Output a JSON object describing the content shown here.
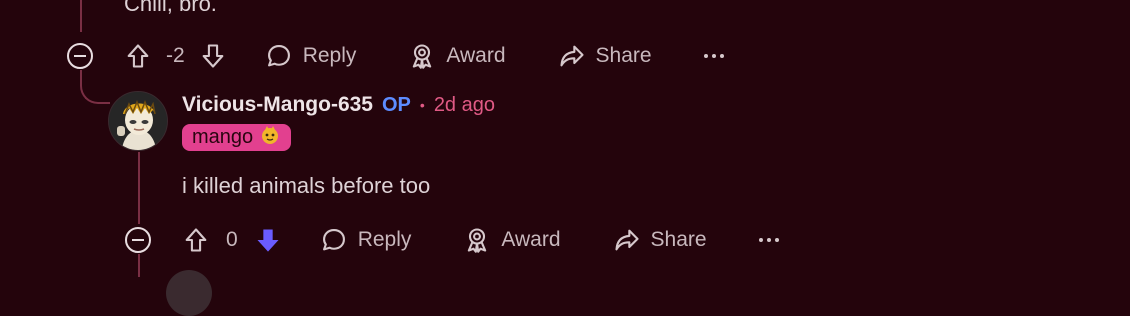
{
  "previous_comment": {
    "text_tail": "Chill, bro.",
    "score": "-2",
    "actions": {
      "reply": "Reply",
      "award": "Award",
      "share": "Share"
    }
  },
  "comment": {
    "username": "Vicious-Mango-635",
    "op_badge": "OP",
    "separator": "•",
    "time": "2d ago",
    "flair_text": "mango",
    "body": "i killed animals before too",
    "score": "0",
    "downvoted": true,
    "actions": {
      "reply": "Reply",
      "award": "Award",
      "share": "Share"
    }
  },
  "colors": {
    "background": "#24040c",
    "thread_line": "#7a2f44",
    "flair": "#e2408f",
    "op": "#5d8cff",
    "time": "#e05a85",
    "downvote_active": "#6a5cff"
  }
}
